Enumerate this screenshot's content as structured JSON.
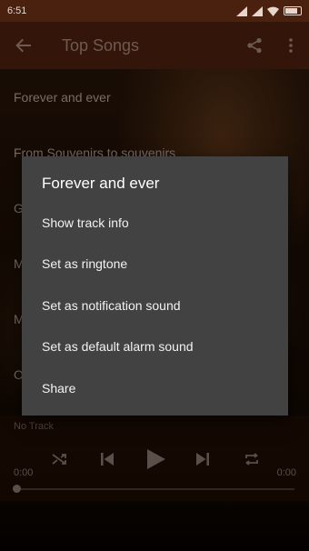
{
  "status_bar": {
    "time": "6:51"
  },
  "app_bar": {
    "title": "Top Songs"
  },
  "song_list": [
    "Forever and ever",
    "From Souvenirs to souvenirs",
    "G",
    "M",
    "M",
    "O"
  ],
  "player": {
    "track": "No Track",
    "elapsed": "0:00",
    "duration": "0:00",
    "progress": 0
  },
  "dialog": {
    "title": "Forever and ever",
    "items": [
      "Show track info",
      "Set as ringtone",
      "Set as notification sound",
      "Set as default alarm sound",
      "Share"
    ]
  },
  "colors": {
    "status_bar": "#4a200e",
    "app_bar": "#4f220f",
    "dialog_background": "#424242"
  },
  "icons": {
    "back": "arrow-left-icon",
    "share": "share-icon",
    "overflow": "more-vert-icon",
    "shuffle": "shuffle-icon",
    "previous": "skip-previous-icon",
    "play": "play-icon",
    "next": "skip-next-icon",
    "repeat": "repeat-icon"
  }
}
